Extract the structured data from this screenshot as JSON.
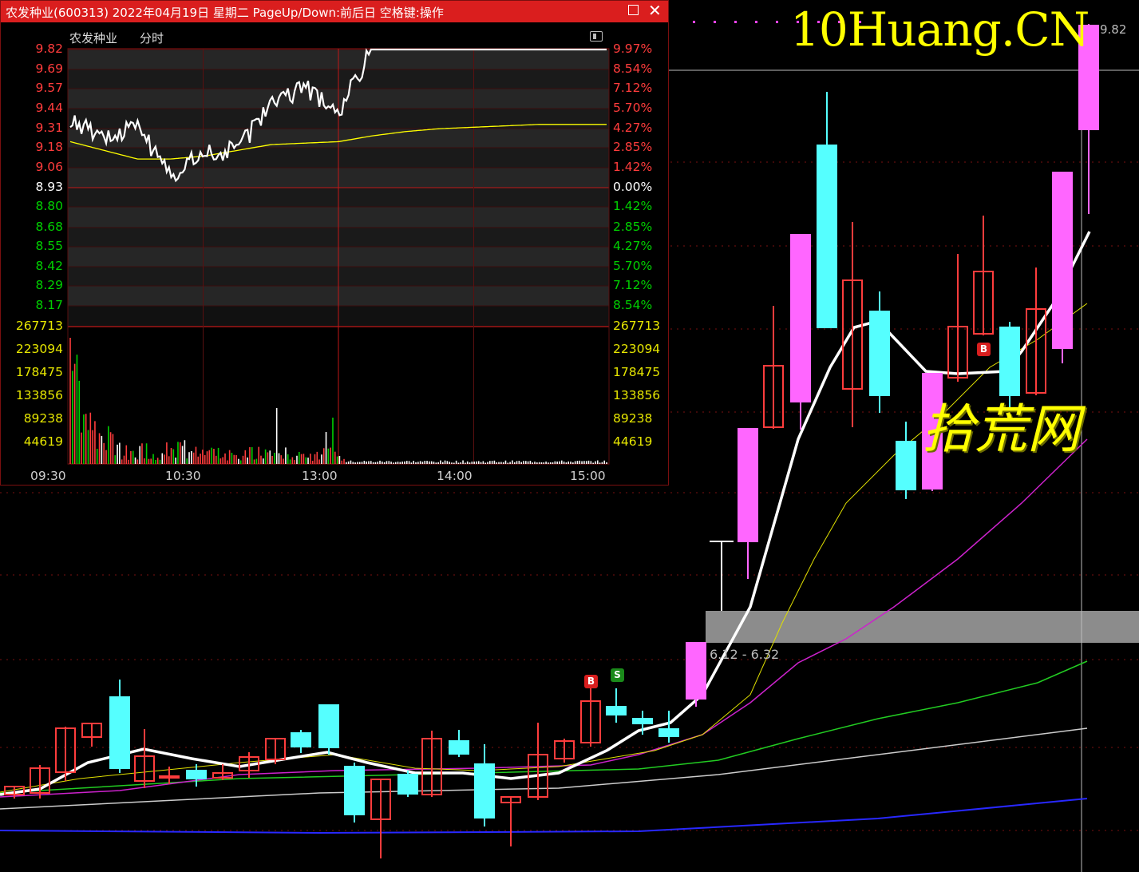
{
  "brand": "10Huang.CN",
  "watermark": "拾荒网",
  "kline": {
    "price_tag": "9.82",
    "zone_label": "6.12 - 6.32",
    "signals": [
      "B",
      "S",
      "B"
    ]
  },
  "window": {
    "title": "农发种业(600313) 2022年04月19日 星期二 PageUp/Down:前后日 空格键:操作",
    "stock_name": "农发种业",
    "mode": "分时",
    "price_labels": [
      "9.82",
      "9.69",
      "9.57",
      "9.44",
      "9.31",
      "9.18",
      "9.06",
      "8.93",
      "8.80",
      "8.68",
      "8.55",
      "8.42",
      "8.29",
      "8.17"
    ],
    "pct_labels": [
      "9.97%",
      "8.54%",
      "7.12%",
      "5.70%",
      "4.27%",
      "2.85%",
      "1.42%",
      "0.00%",
      "1.42%",
      "2.85%",
      "4.27%",
      "5.70%",
      "7.12%",
      "8.54%"
    ],
    "volume_labels": [
      "267713",
      "223094",
      "178475",
      "133856",
      "89238",
      "44619"
    ],
    "time_labels": [
      "09:30",
      "10:30",
      "13:00",
      "14:00",
      "15:00"
    ]
  },
  "colors": {
    "up": "#ff3c3c",
    "down": "#00d000",
    "neutral": "#ffffff",
    "candle_up_fill": "#ff66ff",
    "candle_down": "#55ffff",
    "grid": "#8a1010",
    "avg_line": "#ffff00"
  },
  "chart_data": {
    "type": "line",
    "title": "农发种业 分时",
    "prev_close": 8.93,
    "ylim": [
      8.04,
      9.82
    ],
    "limit_up": 9.82,
    "x": [
      "09:30",
      "09:45",
      "10:00",
      "10:15",
      "10:30",
      "10:45",
      "11:00",
      "11:15",
      "11:30/13:00",
      "13:15",
      "13:30",
      "13:45",
      "14:00",
      "14:15",
      "14:30",
      "14:45",
      "15:00"
    ],
    "series": [
      {
        "values": [
          9.31,
          9.22,
          9.28,
          8.95,
          9.1,
          9.12,
          9.44,
          9.55,
          9.38,
          9.82,
          9.82,
          9.82,
          9.82,
          9.82,
          9.82,
          9.82,
          9.82
        ]
      },
      {
        "values": [
          9.18,
          9.12,
          9.06,
          9.06,
          9.08,
          9.12,
          9.16,
          9.17,
          9.18,
          9.22,
          9.25,
          9.27,
          9.28,
          9.29,
          9.3,
          9.3,
          9.3
        ]
      }
    ],
    "volume_max": 267713
  }
}
